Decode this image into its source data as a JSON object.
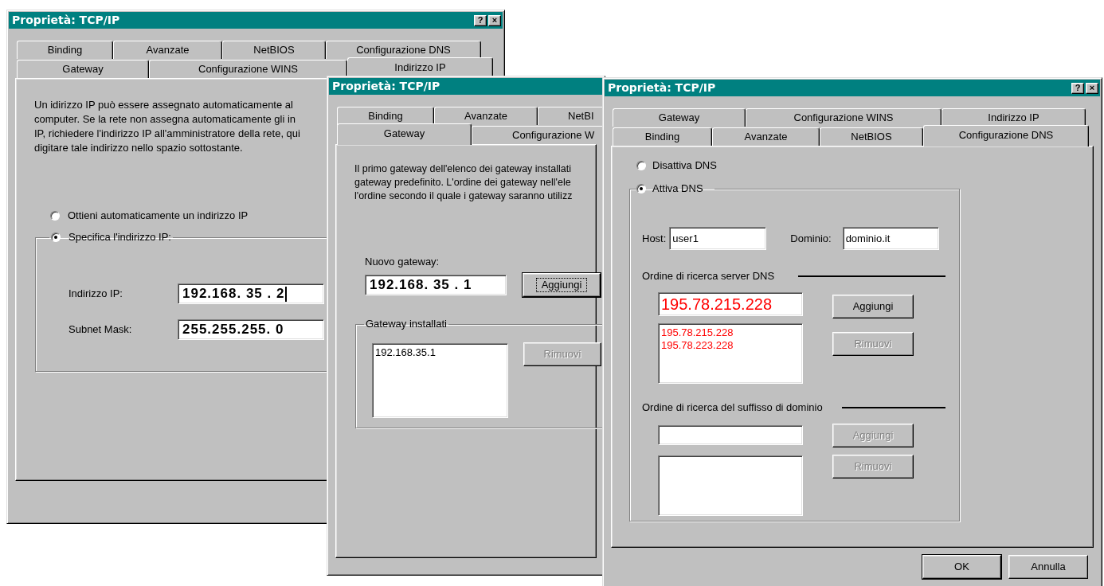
{
  "windows": [
    {
      "kind": "ip",
      "title": "Proprietà: TCP/IP",
      "title_buttons": [
        "?",
        "×"
      ],
      "tab_rows": [
        [
          {
            "label": "Binding",
            "selected": false
          },
          {
            "label": "Avanzate",
            "selected": false
          },
          {
            "label": "NetBIOS",
            "selected": false
          },
          {
            "label": "Configurazione DNS",
            "selected": false
          }
        ],
        [
          {
            "label": "Gateway",
            "selected": false
          },
          {
            "label": "Configurazione WINS",
            "selected": false
          },
          {
            "label": "Indirizzo IP",
            "selected": true
          }
        ]
      ],
      "description": "Un idirizzo IP può essere assegnato automaticamente al\ncomputer. Se la rete non assegna automaticamente gli in\nIP, richiedere l'indirizzo IP all'amministratore della rete, qui\ndigitare tale indirizzo nello spazio sottostante.",
      "options": [
        {
          "label": "Ottieni automaticamente un indirizzo IP",
          "selected": false
        },
        {
          "label": "Specifica l'indirizzo IP:",
          "selected": true
        }
      ],
      "fields": [
        {
          "label": "Indirizzo IP:",
          "value": "192.168. 35 . 2",
          "focused": true
        },
        {
          "label": "Subnet Mask:",
          "value": "255.255.255. 0",
          "focused": false
        }
      ]
    },
    {
      "kind": "gateway",
      "title": "Proprietà: TCP/IP",
      "tab_rows": [
        [
          {
            "label": "Binding",
            "selected": false
          },
          {
            "label": "Avanzate",
            "selected": false
          },
          {
            "label": "NetBI",
            "selected": false
          }
        ],
        [
          {
            "label": "Gateway",
            "selected": true
          },
          {
            "label": "Configurazione W",
            "selected": false
          }
        ]
      ],
      "description": "Il primo gateway dell'elenco dei gateway installati\ngateway predefinito. L'ordine dei gateway nell'ele\nl'ordine secondo il quale i gateway saranno utilizz",
      "new_gateway": {
        "label": "Nuovo gateway:",
        "value": "192.168. 35 . 1"
      },
      "add_button": {
        "label": "Aggiungi",
        "focused": true,
        "disabled": false
      },
      "installed": {
        "label": "Gateway installati",
        "items": [
          "192.168.35.1"
        ]
      },
      "remove_button": {
        "label": "Rimuovi",
        "disabled": true
      }
    },
    {
      "kind": "dns",
      "title": "Proprietà: TCP/IP",
      "title_buttons": [
        "?",
        "×"
      ],
      "tab_rows": [
        [
          {
            "label": "Gateway",
            "selected": false
          },
          {
            "label": "Configurazione WINS",
            "selected": false
          },
          {
            "label": "Indirizzo IP",
            "selected": false
          }
        ],
        [
          {
            "label": "Binding",
            "selected": false
          },
          {
            "label": "Avanzate",
            "selected": false
          },
          {
            "label": "NetBIOS",
            "selected": false
          },
          {
            "label": "Configurazione DNS",
            "selected": true
          }
        ]
      ],
      "options": [
        {
          "label": "Disattiva DNS",
          "selected": false
        },
        {
          "label": "Attiva DNS",
          "selected": true
        }
      ],
      "host": {
        "label": "Host:",
        "value": "user1"
      },
      "domain": {
        "label": "Dominio:",
        "value": "dominio.it"
      },
      "dns_servers": {
        "label": "Ordine di ricerca server DNS",
        "value": "195.78.215.228",
        "items": [
          "195.78.215.228",
          "195.78.223.228"
        ],
        "add_button": {
          "label": "Aggiungi",
          "disabled": false
        },
        "remove_button": {
          "label": "Rimuovi",
          "disabled": true
        }
      },
      "suffixes": {
        "label": "Ordine di ricerca del suffisso di dominio",
        "add_button": {
          "label": "Aggiungi",
          "disabled": true
        },
        "remove_button": {
          "label": "Rimuovi",
          "disabled": true
        }
      },
      "footer_buttons": [
        {
          "label": "OK",
          "default": true
        },
        {
          "label": "Annulla",
          "default": false
        }
      ]
    }
  ]
}
